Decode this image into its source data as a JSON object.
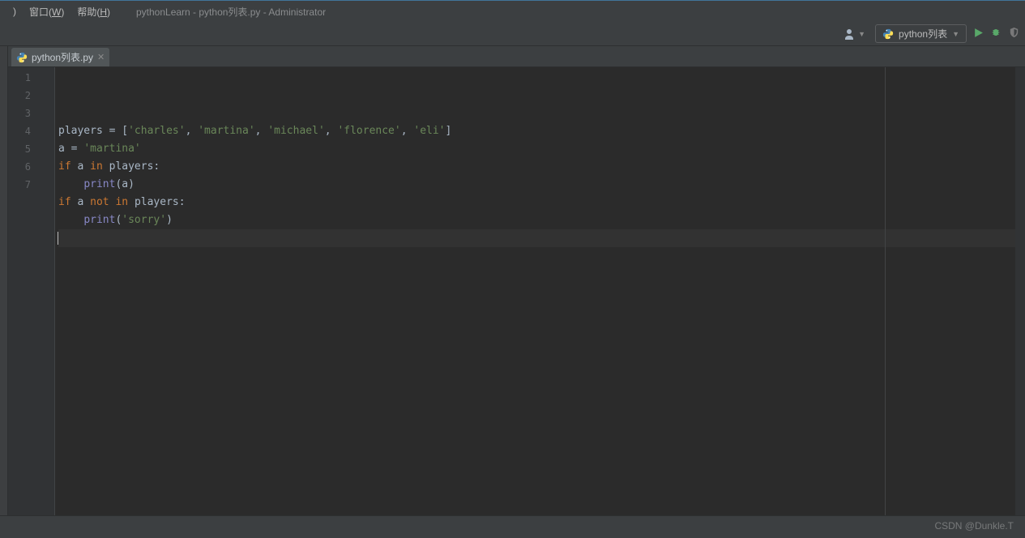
{
  "menubar": {
    "partial": ")",
    "window_label": "窗口(W)",
    "help_label": "帮助(H)",
    "title_path": "pythonLearn - python列表.py - Administrator"
  },
  "toolbar": {
    "run_config": "python列表"
  },
  "tab": {
    "filename": "python列表.py"
  },
  "editor": {
    "lines": [
      "1",
      "2",
      "3",
      "4",
      "5",
      "6",
      "7"
    ],
    "code": [
      {
        "tokens": [
          [
            "id",
            "players"
          ],
          [
            "p",
            " = ["
          ],
          [
            "s",
            "'charles'"
          ],
          [
            "p",
            ", "
          ],
          [
            "s",
            "'martina'"
          ],
          [
            "p",
            ", "
          ],
          [
            "s",
            "'michael'"
          ],
          [
            "p",
            ", "
          ],
          [
            "s",
            "'florence'"
          ],
          [
            "p",
            ", "
          ],
          [
            "s",
            "'eli'"
          ],
          [
            "p",
            "]"
          ]
        ]
      },
      {
        "tokens": [
          [
            "id",
            "a"
          ],
          [
            "p",
            " = "
          ],
          [
            "s",
            "'martina'"
          ]
        ]
      },
      {
        "tokens": [
          [
            "k",
            "if"
          ],
          [
            "p",
            " "
          ],
          [
            "id",
            "a"
          ],
          [
            "p",
            " "
          ],
          [
            "k",
            "in"
          ],
          [
            "p",
            " "
          ],
          [
            "id",
            "players:"
          ]
        ]
      },
      {
        "tokens": [
          [
            "p",
            "    "
          ],
          [
            "fn",
            "print"
          ],
          [
            "p",
            "("
          ],
          [
            "id",
            "a"
          ],
          [
            "p",
            ")"
          ]
        ]
      },
      {
        "tokens": [
          [
            "k",
            "if"
          ],
          [
            "p",
            " "
          ],
          [
            "id",
            "a"
          ],
          [
            "p",
            " "
          ],
          [
            "k",
            "not in"
          ],
          [
            "p",
            " "
          ],
          [
            "id",
            "players:"
          ]
        ]
      },
      {
        "tokens": [
          [
            "p",
            "    "
          ],
          [
            "fn",
            "print"
          ],
          [
            "p",
            "("
          ],
          [
            "s",
            "'sorry'"
          ],
          [
            "p",
            ")"
          ]
        ]
      },
      {
        "tokens": [],
        "cursor": true,
        "highlight": true
      }
    ]
  },
  "watermark": "CSDN @Dunkle.T"
}
